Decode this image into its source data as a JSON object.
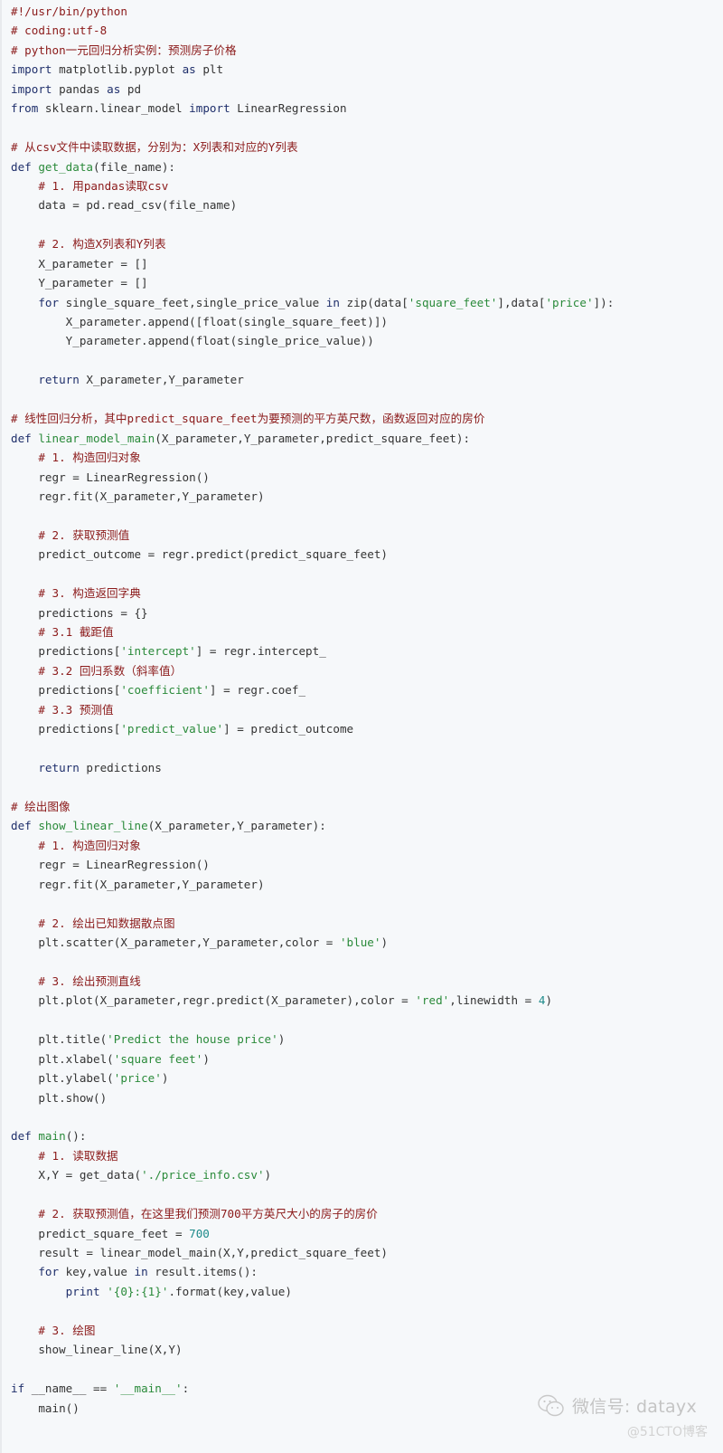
{
  "colors": {
    "background": "#f6f8fa",
    "comment": "#8b1a1a",
    "keyword": "#1f2f6b",
    "function_name": "#2a8a3a",
    "string": "#2a8a3a",
    "number": "#1d8a8a",
    "text": "#333333"
  },
  "code": {
    "language": "python",
    "lines": [
      [
        [
          "c",
          "#!/usr/bin/python"
        ]
      ],
      [
        [
          "c",
          "# coding:utf-8"
        ]
      ],
      [
        [
          "c",
          "# python一元回归分析实例：预测房子价格"
        ]
      ],
      [
        [
          "k",
          "import"
        ],
        [
          "p",
          " matplotlib.pyplot "
        ],
        [
          "k",
          "as"
        ],
        [
          "p",
          " plt"
        ]
      ],
      [
        [
          "k",
          "import"
        ],
        [
          "p",
          " pandas "
        ],
        [
          "k",
          "as"
        ],
        [
          "p",
          " pd"
        ]
      ],
      [
        [
          "k",
          "from"
        ],
        [
          "p",
          " sklearn.linear_model "
        ],
        [
          "k",
          "import"
        ],
        [
          "p",
          " LinearRegression"
        ]
      ],
      [],
      [
        [
          "c",
          "# 从csv文件中读取数据，分别为：X列表和对应的Y列表"
        ]
      ],
      [
        [
          "k",
          "def"
        ],
        [
          "p",
          " "
        ],
        [
          "f",
          "get_data"
        ],
        [
          "p",
          "(file_name):"
        ]
      ],
      [
        [
          "p",
          "    "
        ],
        [
          "c",
          "# 1. 用pandas读取csv"
        ]
      ],
      [
        [
          "p",
          "    data = pd.read_csv(file_name)"
        ]
      ],
      [],
      [
        [
          "p",
          "    "
        ],
        [
          "c",
          "# 2. 构造X列表和Y列表"
        ]
      ],
      [
        [
          "p",
          "    X_parameter = []"
        ]
      ],
      [
        [
          "p",
          "    Y_parameter = []"
        ]
      ],
      [
        [
          "p",
          "    "
        ],
        [
          "k",
          "for"
        ],
        [
          "p",
          " single_square_feet,single_price_value "
        ],
        [
          "k",
          "in"
        ],
        [
          "p",
          " zip(data["
        ],
        [
          "s",
          "'square_feet'"
        ],
        [
          "p",
          "],data["
        ],
        [
          "s",
          "'price'"
        ],
        [
          "p",
          "]):"
        ]
      ],
      [
        [
          "p",
          "        X_parameter.append([float(single_square_feet)])"
        ]
      ],
      [
        [
          "p",
          "        Y_parameter.append(float(single_price_value))"
        ]
      ],
      [],
      [
        [
          "p",
          "    "
        ],
        [
          "k",
          "return"
        ],
        [
          "p",
          " X_parameter,Y_parameter"
        ]
      ],
      [],
      [
        [
          "c",
          "# 线性回归分析，其中predict_square_feet为要预测的平方英尺数，函数返回对应的房价"
        ]
      ],
      [
        [
          "k",
          "def"
        ],
        [
          "p",
          " "
        ],
        [
          "f",
          "linear_model_main"
        ],
        [
          "p",
          "(X_parameter,Y_parameter,predict_square_feet):"
        ]
      ],
      [
        [
          "p",
          "    "
        ],
        [
          "c",
          "# 1. 构造回归对象"
        ]
      ],
      [
        [
          "p",
          "    regr = LinearRegression()"
        ]
      ],
      [
        [
          "p",
          "    regr.fit(X_parameter,Y_parameter)"
        ]
      ],
      [],
      [
        [
          "p",
          "    "
        ],
        [
          "c",
          "# 2. 获取预测值"
        ]
      ],
      [
        [
          "p",
          "    predict_outcome = regr.predict(predict_square_feet)"
        ]
      ],
      [],
      [
        [
          "p",
          "    "
        ],
        [
          "c",
          "# 3. 构造返回字典"
        ]
      ],
      [
        [
          "p",
          "    predictions = {}"
        ]
      ],
      [
        [
          "p",
          "    "
        ],
        [
          "c",
          "# 3.1 截距值"
        ]
      ],
      [
        [
          "p",
          "    predictions["
        ],
        [
          "s",
          "'intercept'"
        ],
        [
          "p",
          "] = regr.intercept_"
        ]
      ],
      [
        [
          "p",
          "    "
        ],
        [
          "c",
          "# 3.2 回归系数（斜率值）"
        ]
      ],
      [
        [
          "p",
          "    predictions["
        ],
        [
          "s",
          "'coefficient'"
        ],
        [
          "p",
          "] = regr.coef_"
        ]
      ],
      [
        [
          "p",
          "    "
        ],
        [
          "c",
          "# 3.3 预测值"
        ]
      ],
      [
        [
          "p",
          "    predictions["
        ],
        [
          "s",
          "'predict_value'"
        ],
        [
          "p",
          "] = predict_outcome"
        ]
      ],
      [],
      [
        [
          "p",
          "    "
        ],
        [
          "k",
          "return"
        ],
        [
          "p",
          " predictions"
        ]
      ],
      [],
      [
        [
          "c",
          "# 绘出图像"
        ]
      ],
      [
        [
          "k",
          "def"
        ],
        [
          "p",
          " "
        ],
        [
          "f",
          "show_linear_line"
        ],
        [
          "p",
          "(X_parameter,Y_parameter):"
        ]
      ],
      [
        [
          "p",
          "    "
        ],
        [
          "c",
          "# 1. 构造回归对象"
        ]
      ],
      [
        [
          "p",
          "    regr = LinearRegression()"
        ]
      ],
      [
        [
          "p",
          "    regr.fit(X_parameter,Y_parameter)"
        ]
      ],
      [],
      [
        [
          "p",
          "    "
        ],
        [
          "c",
          "# 2. 绘出已知数据散点图"
        ]
      ],
      [
        [
          "p",
          "    plt.scatter(X_parameter,Y_parameter,color = "
        ],
        [
          "s",
          "'blue'"
        ],
        [
          "p",
          ")"
        ]
      ],
      [],
      [
        [
          "p",
          "    "
        ],
        [
          "c",
          "# 3. 绘出预测直线"
        ]
      ],
      [
        [
          "p",
          "    plt.plot(X_parameter,regr.predict(X_parameter),color = "
        ],
        [
          "s",
          "'red'"
        ],
        [
          "p",
          ",linewidth = "
        ],
        [
          "n",
          "4"
        ],
        [
          "p",
          ")"
        ]
      ],
      [],
      [
        [
          "p",
          "    plt.title("
        ],
        [
          "s",
          "'Predict the house price'"
        ],
        [
          "p",
          ")"
        ]
      ],
      [
        [
          "p",
          "    plt.xlabel("
        ],
        [
          "s",
          "'square feet'"
        ],
        [
          "p",
          ")"
        ]
      ],
      [
        [
          "p",
          "    plt.ylabel("
        ],
        [
          "s",
          "'price'"
        ],
        [
          "p",
          ")"
        ]
      ],
      [
        [
          "p",
          "    plt.show()"
        ]
      ],
      [],
      [
        [
          "k",
          "def"
        ],
        [
          "p",
          " "
        ],
        [
          "f",
          "main"
        ],
        [
          "p",
          "():"
        ]
      ],
      [
        [
          "p",
          "    "
        ],
        [
          "c",
          "# 1. 读取数据"
        ]
      ],
      [
        [
          "p",
          "    X,Y = get_data("
        ],
        [
          "s",
          "'./price_info.csv'"
        ],
        [
          "p",
          ")"
        ]
      ],
      [],
      [
        [
          "p",
          "    "
        ],
        [
          "c",
          "# 2. 获取预测值，在这里我们预测700平方英尺大小的房子的房价"
        ]
      ],
      [
        [
          "p",
          "    predict_square_feet = "
        ],
        [
          "n",
          "700"
        ]
      ],
      [
        [
          "p",
          "    result = linear_model_main(X,Y,predict_square_feet)"
        ]
      ],
      [
        [
          "p",
          "    "
        ],
        [
          "k",
          "for"
        ],
        [
          "p",
          " key,value "
        ],
        [
          "k",
          "in"
        ],
        [
          "p",
          " result.items():"
        ]
      ],
      [
        [
          "p",
          "        "
        ],
        [
          "k",
          "print"
        ],
        [
          "p",
          " "
        ],
        [
          "s",
          "'{0}:{1}'"
        ],
        [
          "p",
          ".format(key,value)"
        ]
      ],
      [],
      [
        [
          "p",
          "    "
        ],
        [
          "c",
          "# 3. 绘图"
        ]
      ],
      [
        [
          "p",
          "    show_linear_line(X,Y)"
        ]
      ],
      [],
      [
        [
          "k",
          "if"
        ],
        [
          "p",
          " __name__ == "
        ],
        [
          "s",
          "'__main__'"
        ],
        [
          "p",
          ":"
        ]
      ],
      [
        [
          "p",
          "    main()"
        ]
      ]
    ]
  },
  "watermark": {
    "icon": "wechat-icon",
    "line1": "微信号: datayx",
    "line2": "@51CTO博客"
  }
}
